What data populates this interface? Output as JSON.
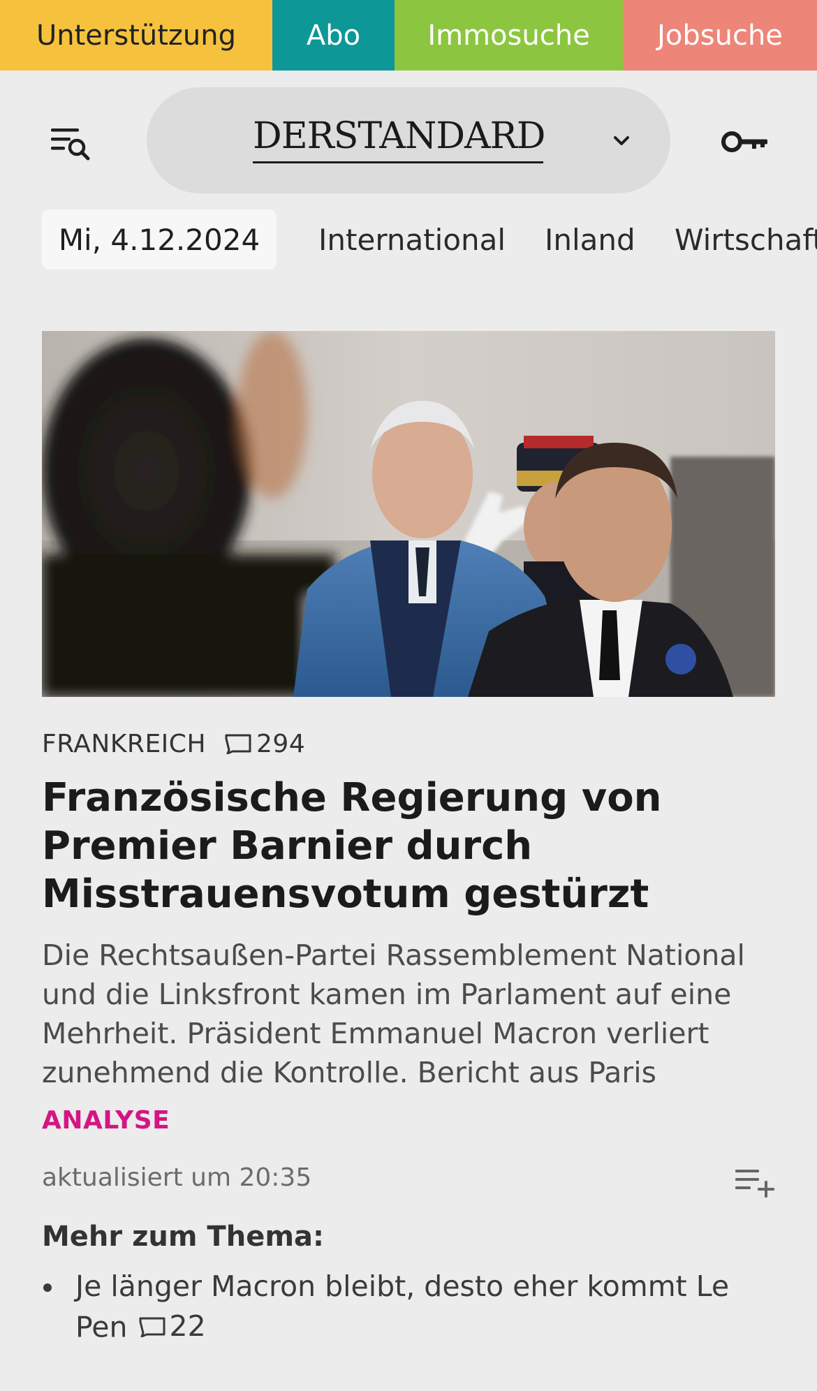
{
  "topbar": {
    "items": [
      {
        "label": "Unterstützung",
        "color": "#f6c23e"
      },
      {
        "label": "Abo",
        "color": "#0e9797"
      },
      {
        "label": "Immosuche",
        "color": "#8cc640"
      },
      {
        "label": "Jobsuche",
        "color": "#ee8579"
      }
    ]
  },
  "header": {
    "menu_icon": "menu-search-icon",
    "brand": "DERSTANDARD",
    "brand_dropdown_icon": "chevron-down-icon",
    "login_icon": "key-icon"
  },
  "nav": {
    "date": "Mi, 4.12.2024",
    "items": [
      "International",
      "Inland",
      "Wirtschaft"
    ]
  },
  "article": {
    "hero_image": "photo-barnier-macron-military-salute",
    "kicker": "FRANKREICH",
    "comments_icon": "comment-icon",
    "comments_count": "294",
    "headline": "Französische Regierung von Premier Barnier durch Misstrauens­votum gestürzt",
    "teaser": "Die Rechtsaußen-Partei Rassemblement National und die Linksfront kamen im Parlament auf eine Mehrheit. Präsident Emmanuel Macron verliert zunehmend die Kontrolle. Bericht aus Paris",
    "badge": "ANALYSE",
    "badge_color": "#d41584",
    "updated": "aktualisiert um 20:35",
    "add_icon": "playlist-add-icon"
  },
  "more": {
    "heading": "Mehr zum Thema:",
    "items": [
      {
        "title": "Je länger Macron bleibt, desto eher kommt Le Pen",
        "comments_count": "22"
      }
    ]
  }
}
